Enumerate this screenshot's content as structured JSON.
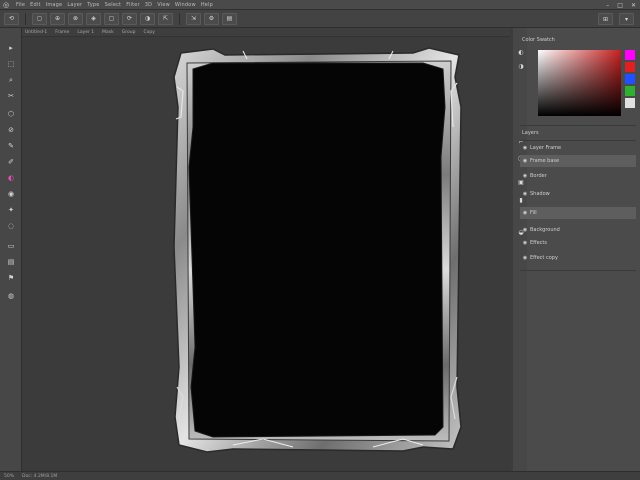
{
  "menubar": {
    "app_icon": "app-logo-icon",
    "menus": [
      "File",
      "Edit",
      "Image",
      "Layer",
      "Type",
      "Select",
      "Filter",
      "3D",
      "View",
      "Window",
      "Help"
    ],
    "window_controls": [
      "–",
      "□",
      "✕"
    ]
  },
  "optionsbar": {
    "buttons": [
      "⟲",
      "◻",
      "⊕",
      "⊗",
      "◈",
      "▢",
      "⟳",
      "◑",
      "⇱",
      "⇲",
      "⚙",
      "▤"
    ],
    "right_buttons": [
      "⊞",
      "▾"
    ]
  },
  "doctabs": {
    "tabs": [
      "Untitled-1",
      "Frame",
      "Layer 1",
      "Mask",
      "Group",
      "Copy"
    ]
  },
  "tools": {
    "items": [
      "▸",
      "⬚",
      "⌕",
      "✂",
      "⬡",
      "⊘",
      "✎",
      "✐",
      "◐",
      "◉",
      "✦",
      "◌",
      "▭",
      "▤",
      "⚑",
      "◍"
    ]
  },
  "panels": {
    "color_title": "Color Swatch",
    "layers_title": "Layers",
    "layers": [
      {
        "eye": "◉",
        "name": "Layer Frame"
      },
      {
        "eye": "◉",
        "name": "Frame base"
      },
      {
        "eye": "◉",
        "name": "Border"
      },
      {
        "eye": "◉",
        "name": "Shadow"
      },
      {
        "eye": "◉",
        "name": "Fill"
      },
      {
        "eye": "◉",
        "name": "Background"
      },
      {
        "eye": "◉",
        "name": "Effects"
      },
      {
        "eye": "◉",
        "name": "Effect copy"
      }
    ]
  },
  "colors": {
    "accent": "#e54fb8",
    "swatch_magenta": "#ff00ff",
    "swatch_red": "#e02020",
    "swatch_blue": "#2050ff",
    "swatch_green": "#30b030",
    "swatch_white": "#e0e0e0",
    "canvas_black": "#050505"
  },
  "status": {
    "zoom": "50%",
    "doc_info": "Doc: 4.2M/8.1M"
  }
}
